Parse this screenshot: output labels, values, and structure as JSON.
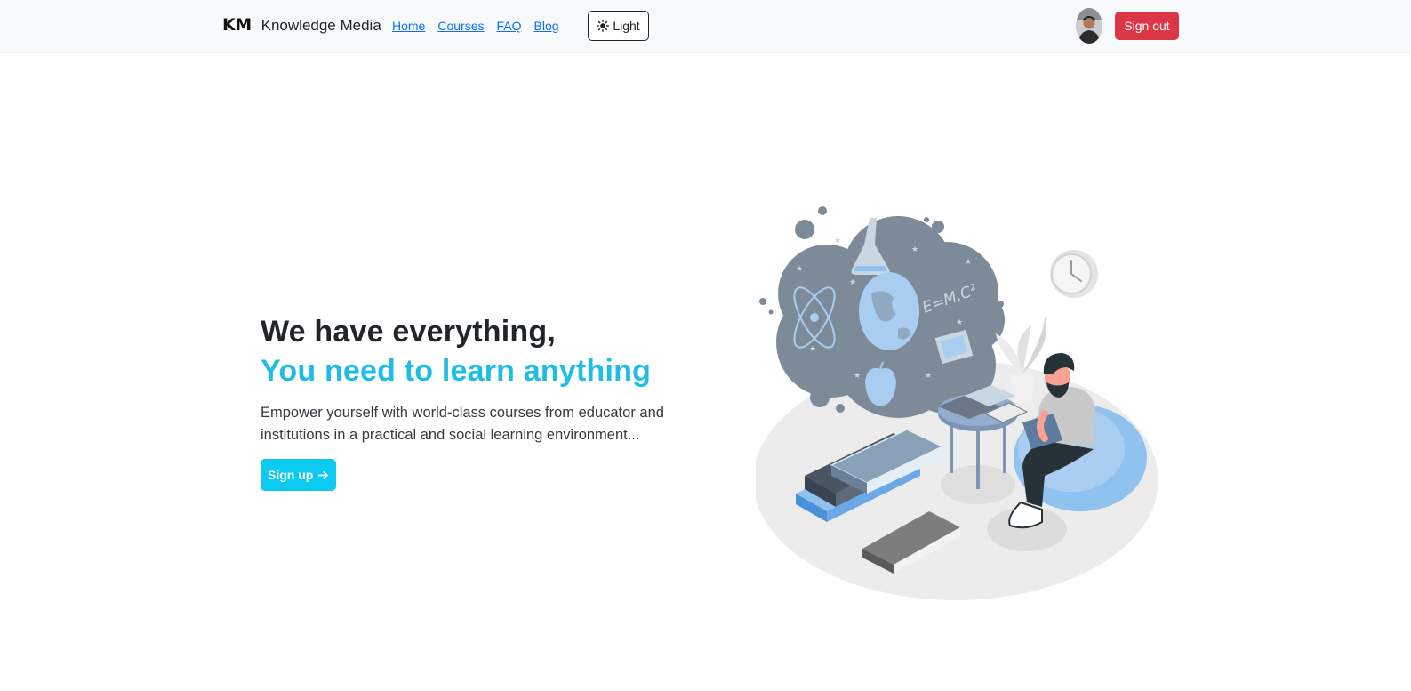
{
  "brand": {
    "mark": "KM",
    "name": "Knowledge Media"
  },
  "nav": {
    "links": [
      "Home",
      "Courses",
      "FAQ",
      "Blog"
    ]
  },
  "theme_toggle": {
    "icon": "sun-icon",
    "label": "Light"
  },
  "user": {
    "avatar_icon": "user-avatar",
    "signout_label": "Sign out"
  },
  "hero": {
    "headline_1": "We have everything,",
    "headline_2": "You need to learn anything",
    "lead": "Empower yourself with world-class courses from educator and institutions in a practical and social learning environment...",
    "signup_label": "Sign up",
    "signup_icon": "arrow-right-icon"
  },
  "colors": {
    "accent": "#1ebee4",
    "button_info": "#0dcaf0",
    "button_danger": "#dc3545",
    "link": "#0d6efd",
    "navbar_bg": "#f8f9fa"
  }
}
